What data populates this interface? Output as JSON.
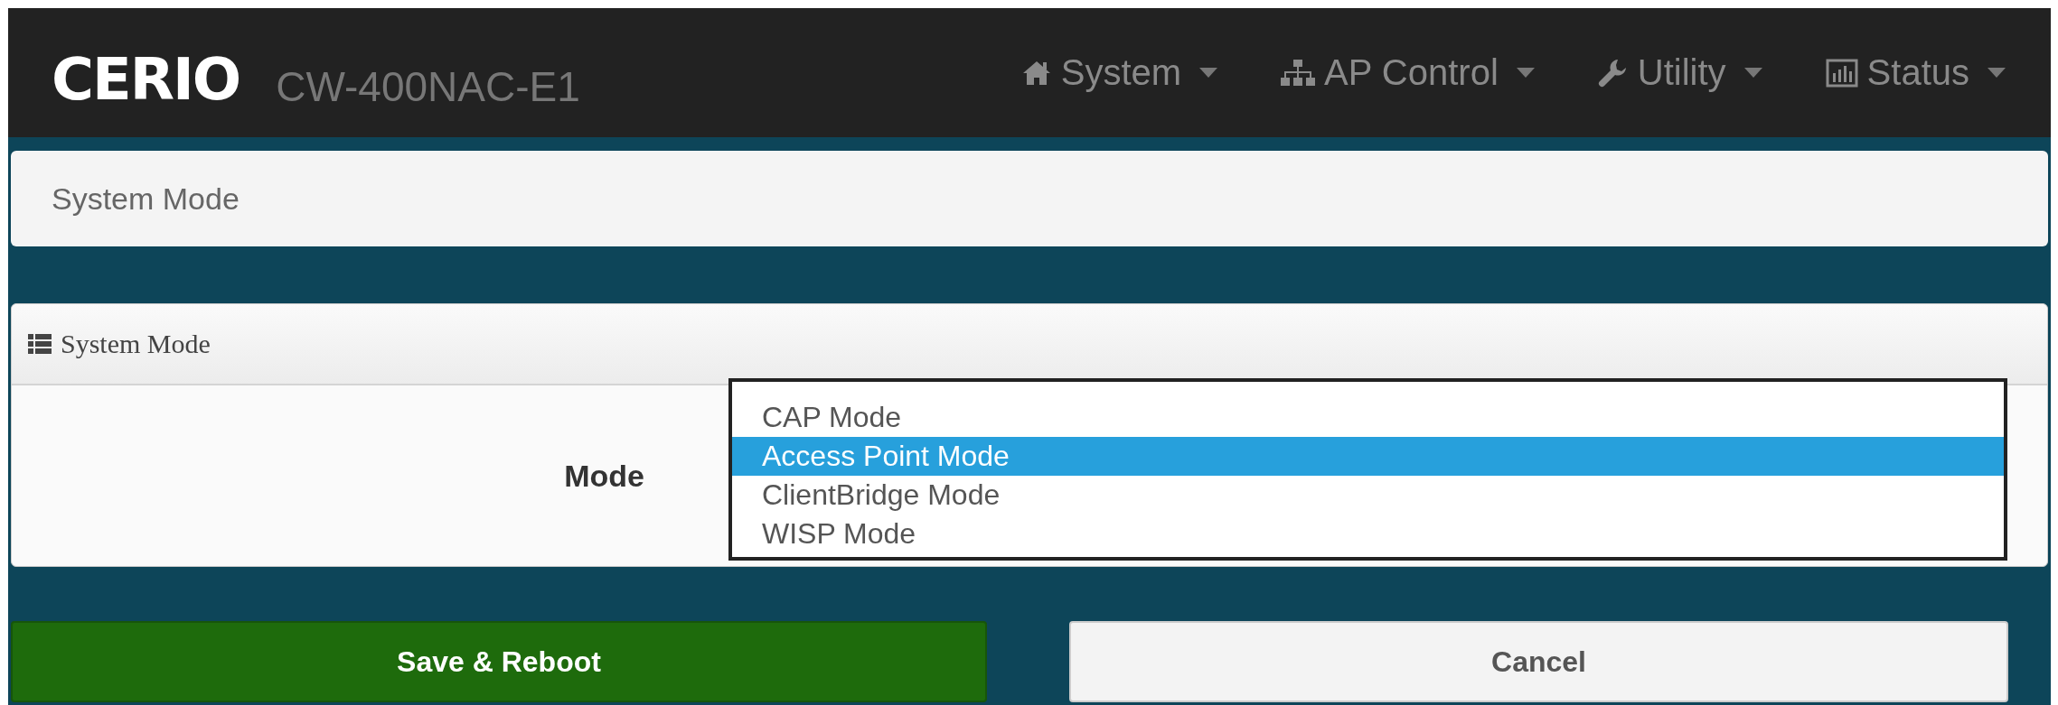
{
  "header": {
    "logo": "CERIO",
    "model": "CW-400NAC-E1",
    "nav": [
      {
        "label": "System"
      },
      {
        "label": "AP Control"
      },
      {
        "label": "Utility"
      },
      {
        "label": "Status"
      }
    ]
  },
  "page_title": "System Mode",
  "panel": {
    "title": "System Mode",
    "field": {
      "label": "Mode",
      "options": [
        {
          "label": "CAP Mode",
          "selected": false
        },
        {
          "label": "Access Point Mode",
          "selected": true
        },
        {
          "label": "ClientBridge Mode",
          "selected": false
        },
        {
          "label": "WISP Mode",
          "selected": false
        }
      ]
    }
  },
  "buttons": [
    {
      "label": "Save & Reboot",
      "kind": "primary"
    },
    {
      "label": "Cancel",
      "kind": "default"
    }
  ]
}
